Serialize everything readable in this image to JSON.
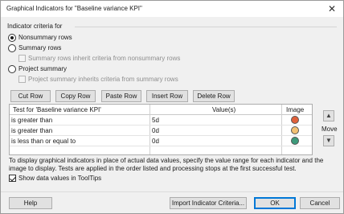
{
  "window": {
    "title": "Graphical Indicators for \"Baseline variance KPI\""
  },
  "criteria": {
    "group_label": "Indicator criteria for",
    "nonsummary": "Nonsummary rows",
    "summary": "Summary rows",
    "summary_inherit": "Summary rows inherit criteria from nonsummary rows",
    "project_summary": "Project summary",
    "project_inherit": "Project summary inherits criteria from summary rows"
  },
  "toolbar": {
    "cut": "Cut Row",
    "copy": "Copy Row",
    "paste": "Paste Row",
    "insert": "Insert Row",
    "delete": "Delete Row"
  },
  "grid": {
    "headers": [
      "Test for 'Baseline variance KPI'",
      "Value(s)",
      "Image"
    ],
    "rows": [
      {
        "test": "is greater than",
        "value": "5d",
        "color": "#e0603a"
      },
      {
        "test": "is greater than",
        "value": "0d",
        "color": "#f2c073"
      },
      {
        "test": "is less than or equal to",
        "value": "0d",
        "color": "#3c9a7a"
      }
    ]
  },
  "move": {
    "label": "Move",
    "up_icon": "triangle-up",
    "down_icon": "triangle-down"
  },
  "info_text": "To display graphical indicators in place of actual data values, specify the value range for each indicator and the image to display. Tests are applied in the order listed and processing stops at the first successful test.",
  "tooltips_label": "Show data values in ToolTips",
  "footer": {
    "help": "Help",
    "import": "Import Indicator Criteria...",
    "ok": "OK",
    "cancel": "Cancel"
  }
}
